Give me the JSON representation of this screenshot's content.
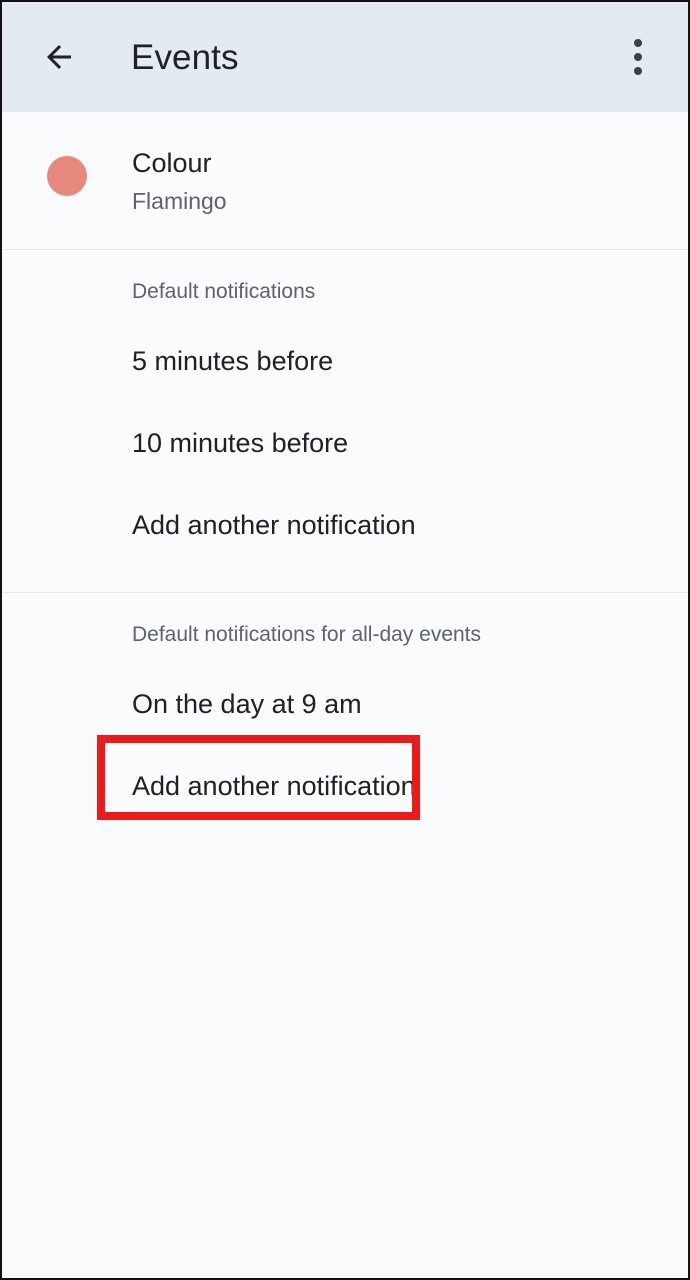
{
  "appbar": {
    "back_icon": "arrow-left-icon",
    "title": "Events",
    "overflow_icon": "more-vertical-icon"
  },
  "colour_row": {
    "swatch_icon": "colour-swatch-circle",
    "label": "Colour",
    "value": "Flamingo",
    "swatch_color": "#e8897e"
  },
  "sections": [
    {
      "header": "Default notifications",
      "items": [
        "5 minutes before",
        "10 minutes before",
        "Add another notification"
      ]
    },
    {
      "header": "Default notifications for all-day events",
      "items": [
        "On the day at 9 am",
        "Add another notification"
      ]
    }
  ],
  "annotation": {
    "target_label": "On the day at 9 am",
    "color": "#ec1b1b"
  }
}
